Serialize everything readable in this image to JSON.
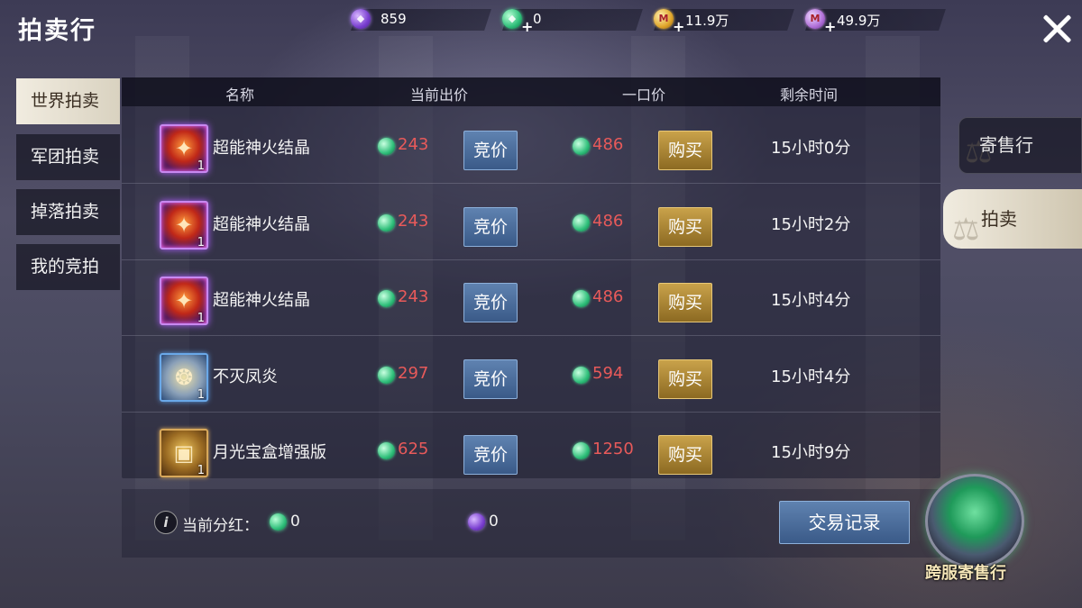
{
  "title": "拍卖行",
  "currencies": [
    {
      "icon": "purple-crystal-icon",
      "value": "859",
      "has_plus": false
    },
    {
      "icon": "green-gem-icon",
      "value": "0",
      "has_plus": true
    },
    {
      "icon": "gold-coin-icon",
      "value": "11.9万",
      "has_plus": true
    },
    {
      "icon": "violet-coin-icon",
      "value": "49.9万",
      "has_plus": true
    }
  ],
  "left_tabs": [
    {
      "label": "世界拍卖",
      "active": true
    },
    {
      "label": "军团拍卖",
      "active": false
    },
    {
      "label": "掉落拍卖",
      "active": false
    },
    {
      "label": "我的竞拍",
      "active": false
    }
  ],
  "table": {
    "headers": {
      "name": "名称",
      "current_bid": "当前出价",
      "buyout": "一口价",
      "remaining": "剩余时间"
    },
    "rows": [
      {
        "icon": "fire-crystal-icon",
        "qty": "1",
        "name": "超能神火结晶",
        "bid": "243",
        "bid_button": "竞价",
        "buyout": "486",
        "buy_button": "购买",
        "time": "15小时0分"
      },
      {
        "icon": "fire-crystal-icon",
        "qty": "1",
        "name": "超能神火结晶",
        "bid": "243",
        "bid_button": "竞价",
        "buyout": "486",
        "buy_button": "购买",
        "time": "15小时2分"
      },
      {
        "icon": "fire-crystal-icon",
        "qty": "1",
        "name": "超能神火结晶",
        "bid": "243",
        "bid_button": "竞价",
        "buyout": "486",
        "buy_button": "购买",
        "time": "15小时4分"
      },
      {
        "icon": "phoenix-flame-icon",
        "qty": "1",
        "name": "不灭凤炎",
        "bid": "297",
        "bid_button": "竞价",
        "buyout": "594",
        "buy_button": "购买",
        "time": "15小时4分"
      },
      {
        "icon": "treasure-box-icon",
        "qty": "1",
        "name": "月光宝盒增强版",
        "bid": "625",
        "bid_button": "竞价",
        "buyout": "1250",
        "buy_button": "购买",
        "time": "15小时9分"
      }
    ]
  },
  "right_tabs": [
    {
      "label": "寄售行",
      "active": false
    },
    {
      "label": "拍卖",
      "active": true
    }
  ],
  "bottom": {
    "bonus_label": "当前分红：",
    "bonus_green": "0",
    "bonus_purple": "0",
    "record_button": "交易记录"
  },
  "cross_server": {
    "label": "跨服寄售行"
  },
  "colors": {
    "price_red": "#e85a5a",
    "bid_blue": "#3a5a88",
    "buy_gold": "#b08a30",
    "active_tab": "#f1ece0"
  }
}
